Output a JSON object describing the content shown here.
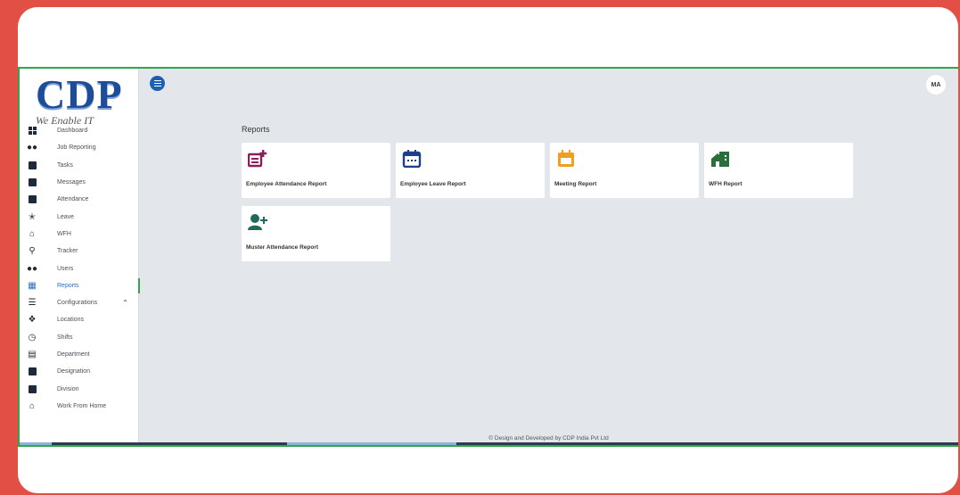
{
  "logo": {
    "text": "CDP",
    "tagline": "We Enable IT"
  },
  "sidebar": {
    "items": [
      {
        "label": "Dashboard",
        "icon": "dashboard-icon"
      },
      {
        "label": "Job Reporting",
        "icon": "group-icon"
      },
      {
        "label": "Tasks",
        "icon": "task-icon"
      },
      {
        "label": "Messages",
        "icon": "message-icon"
      },
      {
        "label": "Attendance",
        "icon": "attendance-icon"
      },
      {
        "label": "Leave",
        "icon": "walk-icon"
      },
      {
        "label": "WFH",
        "icon": "home-icon"
      },
      {
        "label": "Tracker",
        "icon": "location-pin-icon"
      },
      {
        "label": "Users",
        "icon": "users-icon"
      },
      {
        "label": "Reports",
        "icon": "report-icon",
        "active": true
      },
      {
        "label": "Configurations",
        "icon": "config-icon",
        "expanded": true
      },
      {
        "label": "Locations",
        "icon": "map-icon"
      },
      {
        "label": "Shifts",
        "icon": "clock-icon"
      },
      {
        "label": "Department",
        "icon": "department-icon"
      },
      {
        "label": "Designation",
        "icon": "designation-icon"
      },
      {
        "label": "Division",
        "icon": "division-icon"
      },
      {
        "label": "Work From Home",
        "icon": "home-icon"
      }
    ]
  },
  "header": {
    "avatar_initials": "MA"
  },
  "main": {
    "title": "Reports",
    "reports": [
      {
        "label": "Employee Attendance Report",
        "icon": "add-note-icon",
        "color": "#8a1f58"
      },
      {
        "label": "Employee Leave Report",
        "icon": "calendar-icon",
        "color": "#1c3f8a"
      },
      {
        "label": "Meeting Report",
        "icon": "event-icon",
        "color": "#f0a020"
      },
      {
        "label": "WFH Report",
        "icon": "home-work-icon",
        "color": "#2a6f3a"
      },
      {
        "label": "Muster Attendance Report",
        "icon": "person-add-icon",
        "color": "#1f6a5a"
      }
    ]
  },
  "footer": {
    "text": "© Design and Developed by CDP India Pvt Ltd"
  },
  "colors": {
    "background": "#e14f45",
    "frame": "#2ea64a",
    "accent": "#1d5fb4"
  }
}
